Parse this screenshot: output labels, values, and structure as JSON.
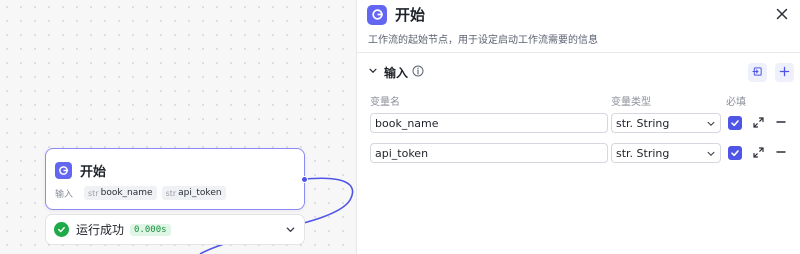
{
  "node": {
    "title": "开始",
    "inputs_label": "输入",
    "inputs": [
      {
        "type": "str",
        "name": "book_name"
      },
      {
        "type": "str",
        "name": "api_token"
      }
    ]
  },
  "run_status": {
    "text": "运行成功",
    "duration": "0.000s"
  },
  "panel": {
    "title": "开始",
    "description": "工作流的起始节点，用于设定启动工作流需要的信息",
    "section_label": "输入",
    "columns": {
      "name": "变量名",
      "type": "变量类型",
      "required": "必填"
    },
    "rows": [
      {
        "name": "book_name",
        "type": "str. String",
        "required": true
      },
      {
        "name": "api_token",
        "type": "str. String",
        "required": true
      }
    ]
  },
  "colors": {
    "accent": "#6366f1",
    "success": "#1faa4a",
    "checkbox": "#4f55e6"
  },
  "icons": [
    "start-node-icon",
    "success-icon",
    "chevron-down-icon",
    "close-icon",
    "collapse-icon",
    "info-icon",
    "import-icon",
    "plus-icon",
    "expand-icon",
    "minus-icon"
  ]
}
